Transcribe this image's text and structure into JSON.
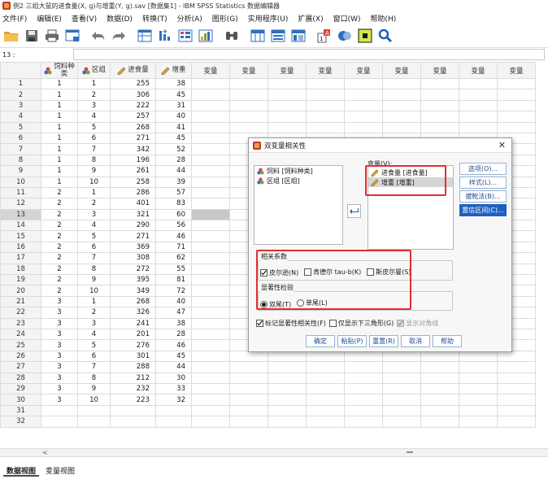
{
  "window": {
    "title": "例2 三组大鼠的进食量(X, g)与增重(Y, g).sav [数据集1] - IBM SPSS Statistics 数据编辑器"
  },
  "menu": [
    "文件(F)",
    "编辑(E)",
    "查看(V)",
    "数据(D)",
    "转换(T)",
    "分析(A)",
    "图形(G)",
    "实用程序(U)",
    "扩展(X)",
    "窗口(W)",
    "帮助(H)"
  ],
  "toolbar": [
    "open-folder-icon",
    "save-icon",
    "print-icon",
    "recall-dialog-icon",
    "undo-icon",
    "redo-icon",
    "go-to-case-icon",
    "go-to-variable-icon",
    "variables-icon",
    "run-descriptives-icon",
    "find-icon",
    "split-file-icon",
    "weight-cases-icon",
    "select-cases-icon",
    "value-labels-icon",
    "use-sets-icon",
    "show-all-variables-icon",
    "search-icon"
  ],
  "cell_editor": {
    "ref": "13 :",
    "value": ""
  },
  "grid": {
    "headers": {
      "a_line1": "饲料种",
      "a_line2": "类",
      "b": "区组",
      "c": "进食量",
      "d": "增重",
      "var": "变量"
    },
    "rows": [
      [
        1,
        1,
        255,
        38
      ],
      [
        1,
        2,
        306,
        45
      ],
      [
        1,
        3,
        222,
        31
      ],
      [
        1,
        4,
        257,
        40
      ],
      [
        1,
        5,
        268,
        41
      ],
      [
        1,
        6,
        271,
        45
      ],
      [
        1,
        7,
        342,
        52
      ],
      [
        1,
        8,
        196,
        28
      ],
      [
        1,
        9,
        261,
        44
      ],
      [
        1,
        10,
        258,
        39
      ],
      [
        2,
        1,
        286,
        57
      ],
      [
        2,
        2,
        401,
        83
      ],
      [
        2,
        3,
        321,
        60
      ],
      [
        2,
        4,
        290,
        56
      ],
      [
        2,
        5,
        271,
        46
      ],
      [
        2,
        6,
        369,
        71
      ],
      [
        2,
        7,
        308,
        62
      ],
      [
        2,
        8,
        272,
        55
      ],
      [
        2,
        9,
        395,
        81
      ],
      [
        2,
        10,
        349,
        72
      ],
      [
        3,
        1,
        268,
        40
      ],
      [
        3,
        2,
        326,
        47
      ],
      [
        3,
        3,
        241,
        38
      ],
      [
        3,
        4,
        201,
        28
      ],
      [
        3,
        5,
        276,
        46
      ],
      [
        3,
        6,
        301,
        45
      ],
      [
        3,
        7,
        288,
        44
      ],
      [
        3,
        8,
        212,
        30
      ],
      [
        3,
        9,
        232,
        33
      ],
      [
        3,
        10,
        223,
        32
      ]
    ],
    "total_row_numbers": 32,
    "selected_row": 13
  },
  "tabs": {
    "data_view": "数据视图",
    "variable_view": "变量视图"
  },
  "dialog": {
    "title": "双变量相关性",
    "close": "✕",
    "source_list": [
      "饲料 [饲料种类]",
      "区组 [区组]"
    ],
    "variables_label": "变量(V):",
    "variables": [
      "进食量 [进食量]",
      "增重 [增重]"
    ],
    "buttons_right": [
      "选项(O)...",
      "样式(L)...",
      "拔靴法(B)...",
      "置信区间(C)..."
    ],
    "corr_group_label": "相关系数",
    "corr_options": [
      {
        "label": "皮尔逊(N)",
        "checked": true
      },
      {
        "label": "肯德尔 tau-b(K)",
        "checked": false
      },
      {
        "label": "斯皮尔曼(S)",
        "checked": false
      }
    ],
    "sig_group_label": "显著性检验",
    "sig_options": [
      {
        "label": "双尾(T)",
        "checked": true
      },
      {
        "label": "单尾(L)",
        "checked": false
      }
    ],
    "flag_sig": "标记显著性相关性(F)",
    "lower_triangle": "仅显示下三角形(G)",
    "show_diagonal": "显示对角线",
    "bottom_buttons": [
      "确定",
      "粘贴(P)",
      "重置(R)",
      "取消",
      "帮助"
    ]
  },
  "colors": {
    "highlight_red": "#e03030",
    "dialog_primary_blue": "#1f5fbf",
    "selected_row_gray": "#c8c8c8"
  }
}
